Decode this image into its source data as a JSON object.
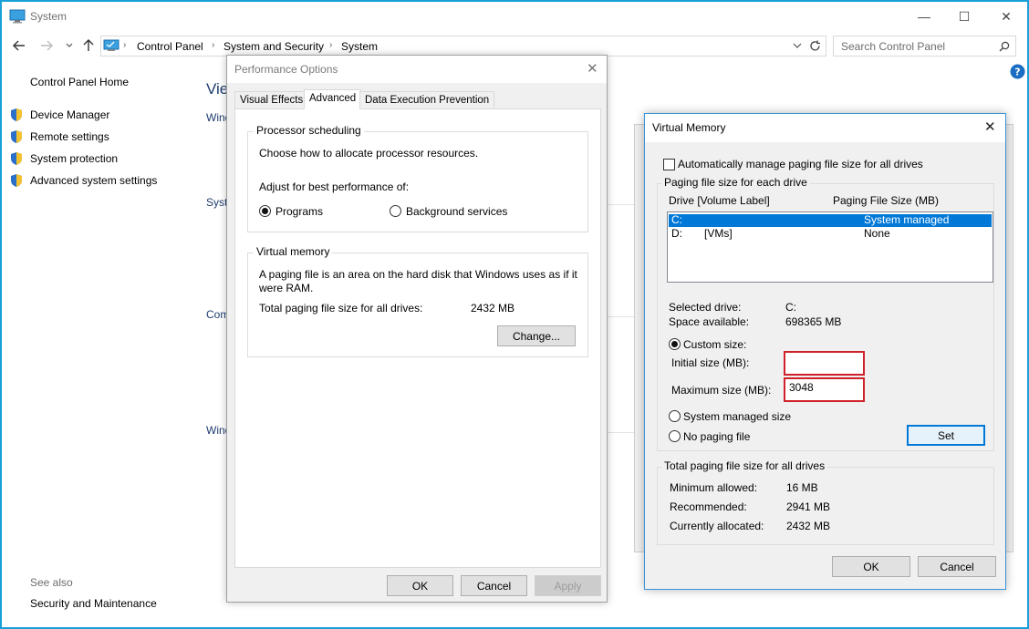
{
  "window": {
    "title": "System",
    "minimize": "—",
    "maximize": "☐",
    "close": "✕"
  },
  "address": {
    "crumbs": [
      "Control Panel",
      "System and Security",
      "System"
    ],
    "search_placeholder": "Search Control Panel"
  },
  "sidebar": {
    "home": "Control Panel Home",
    "items": [
      {
        "label": "Device Manager"
      },
      {
        "label": "Remote settings"
      },
      {
        "label": "System protection"
      },
      {
        "label": "Advanced system settings"
      }
    ],
    "see_also": "See also",
    "security_link": "Security and Maintenance"
  },
  "background": {
    "heading_frag": "View",
    "frag_1": "Wind",
    "frag_2": "Syste",
    "frag_3": "Com",
    "frag_4": "Wind"
  },
  "perf_dialog": {
    "title": "Performance Options",
    "tabs": [
      "Visual Effects",
      "Advanced",
      "Data Execution Prevention"
    ],
    "processor": {
      "legend": "Processor scheduling",
      "desc": "Choose how to allocate processor resources.",
      "adjust": "Adjust for best performance of:",
      "opt_programs": "Programs",
      "opt_background": "Background services"
    },
    "vmem": {
      "legend": "Virtual memory",
      "desc_1": "A paging file is an area on the hard disk that Windows uses as if it",
      "desc_2": "were RAM.",
      "total_label": "Total paging file size for all drives:",
      "total_value": "2432 MB",
      "change": "Change..."
    },
    "ok": "OK",
    "cancel": "Cancel",
    "apply": "Apply"
  },
  "vm_dialog": {
    "title": "Virtual Memory",
    "auto_manage": "Automatically manage paging file size for all drives",
    "group_legend": "Paging file size for each drive",
    "col_drive": "Drive  [Volume Label]",
    "col_size": "Paging File Size (MB)",
    "drives": [
      {
        "drive": "C:",
        "label": "",
        "size": "System managed"
      },
      {
        "drive": "D:",
        "label": "[VMs]",
        "size": "None"
      }
    ],
    "selected_drive_label": "Selected drive:",
    "selected_drive_value": "C:",
    "space_label": "Space available:",
    "space_value": "698365 MB",
    "custom_size": "Custom size:",
    "initial_label": "Initial size (MB):",
    "initial_value": "",
    "max_label": "Maximum size (MB):",
    "max_value": "3048",
    "system_managed": "System managed size",
    "no_paging": "No paging file",
    "set": "Set",
    "total_legend": "Total paging file size for all drives",
    "min_label": "Minimum allowed:",
    "min_value": "16 MB",
    "rec_label": "Recommended:",
    "rec_value": "2941 MB",
    "cur_label": "Currently allocated:",
    "cur_value": "2432 MB",
    "ok": "OK",
    "cancel": "Cancel"
  },
  "colors": {
    "accent": "#0078d7",
    "window_border": "#1aa0d8",
    "highlight_box": "#d0202a",
    "help_icon": "#1a6dc2"
  }
}
